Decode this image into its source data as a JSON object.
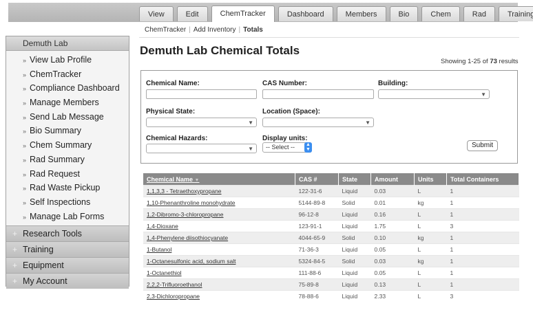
{
  "tabs": [
    {
      "label": "View",
      "active": false
    },
    {
      "label": "Edit",
      "active": false
    },
    {
      "label": "ChemTracker",
      "active": true
    },
    {
      "label": "Dashboard",
      "active": false
    },
    {
      "label": "Members",
      "active": false
    },
    {
      "label": "Bio",
      "active": false
    },
    {
      "label": "Chem",
      "active": false
    },
    {
      "label": "Rad",
      "active": false
    },
    {
      "label": "Training",
      "active": false
    }
  ],
  "sidebar": {
    "head": "Demuth Lab",
    "items": [
      {
        "label": "View Lab Profile"
      },
      {
        "label": "ChemTracker"
      },
      {
        "label": "Compliance Dashboard"
      },
      {
        "label": "Manage Members"
      },
      {
        "label": "Send Lab Message"
      },
      {
        "label": "Bio Summary"
      },
      {
        "label": "Chem Summary"
      },
      {
        "label": "Rad Summary"
      },
      {
        "label": "Rad Request"
      },
      {
        "label": "Rad Waste Pickup"
      },
      {
        "label": "Self Inspections"
      },
      {
        "label": "Manage Lab Forms"
      }
    ],
    "sections": [
      {
        "label": "Research Tools"
      },
      {
        "label": "Training"
      },
      {
        "label": "Equipment"
      },
      {
        "label": "My Account"
      }
    ]
  },
  "breadcrumb": {
    "item1": "ChemTracker",
    "item2": "Add Inventory",
    "current": "Totals"
  },
  "title": "Demuth Lab Chemical Totals",
  "showing": {
    "prefix": "Showing 1-25 of",
    "total": "73",
    "suffix": "results"
  },
  "filters": {
    "chemical_name_label": "Chemical Name:",
    "cas_label": "CAS Number:",
    "building_label": "Building:",
    "physical_state_label": "Physical State:",
    "location_label": "Location (Space):",
    "hazards_label": "Chemical Hazards:",
    "units_label": "Display units:",
    "units_value": "-- Select --",
    "submit_label": "Submit"
  },
  "table": {
    "headers": [
      "Chemical Name",
      "CAS #",
      "State",
      "Amount",
      "Units",
      "Total Containers"
    ],
    "rows": [
      [
        "1,1,3,3 - Tetraethoxypropane",
        "122-31-6",
        "Liquid",
        "0.03",
        "L",
        "1"
      ],
      [
        "1,10-Phenanthroline monohydrate",
        "5144-89-8",
        "Solid",
        "0.01",
        "kg",
        "1"
      ],
      [
        "1,2-Dibromo-3-chloropropane",
        "96-12-8",
        "Liquid",
        "0.16",
        "L",
        "1"
      ],
      [
        "1,4-Dioxane",
        "123-91-1",
        "Liquid",
        "1.75",
        "L",
        "3"
      ],
      [
        "1,4-Phenylene diisothiocyanate",
        "4044-65-9",
        "Solid",
        "0.10",
        "kg",
        "1"
      ],
      [
        "1-Butanol",
        "71-36-3",
        "Liquid",
        "0.05",
        "L",
        "1"
      ],
      [
        "1-Octanesulfonic acid, sodium salt",
        "5324-84-5",
        "Solid",
        "0.03",
        "kg",
        "1"
      ],
      [
        "1-Octanethiol",
        "111-88-6",
        "Liquid",
        "0.05",
        "L",
        "1"
      ],
      [
        "2,2,2-Trifluoroethanol",
        "75-89-8",
        "Liquid",
        "0.13",
        "L",
        "1"
      ],
      [
        "2,3-Dichloropropane",
        "78-88-6",
        "Liquid",
        "2.33",
        "L",
        "3"
      ]
    ]
  }
}
